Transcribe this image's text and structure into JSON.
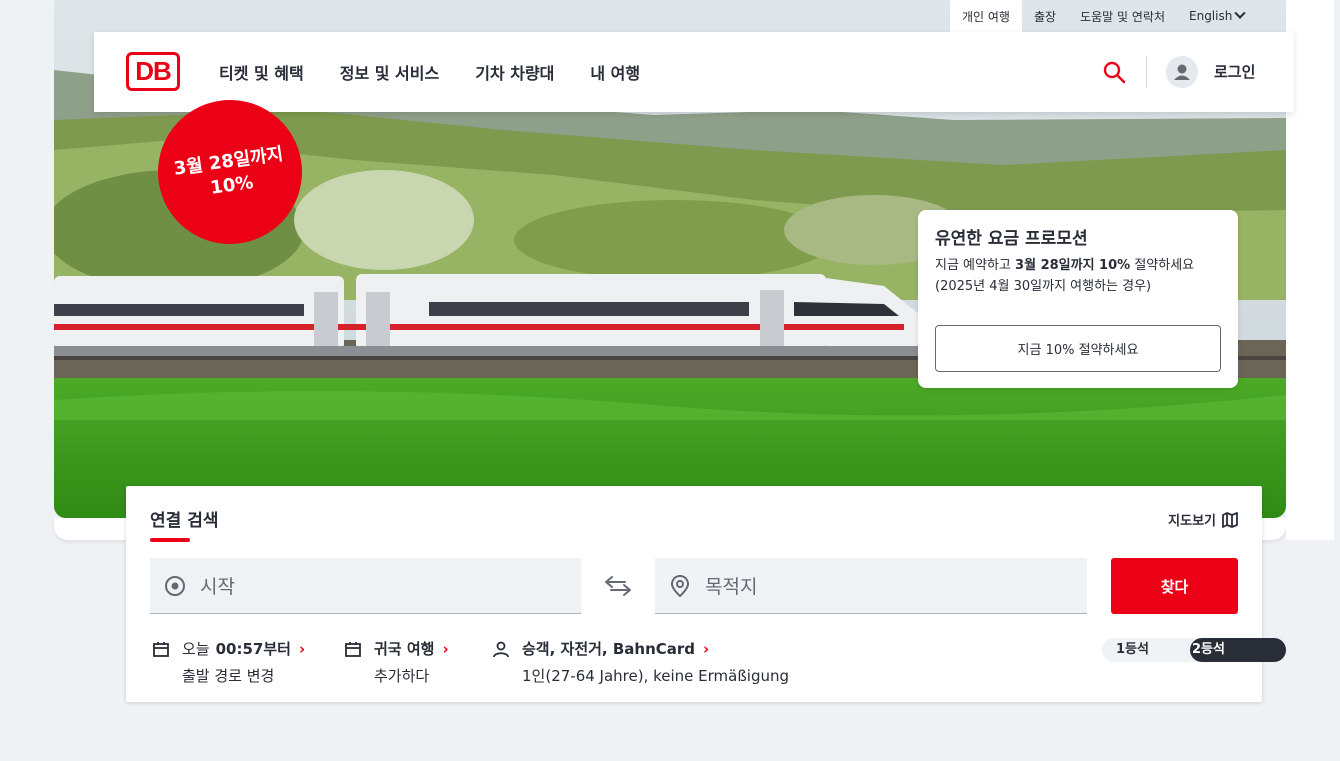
{
  "meta_nav": {
    "items": [
      {
        "label": "개인 여행"
      },
      {
        "label": "출장"
      },
      {
        "label": "도움말 및 연락처"
      }
    ],
    "language": "English"
  },
  "header": {
    "logo": "DB",
    "nav": [
      "티켓 및 혜택",
      "정보 및 서비스",
      "기차 차량대",
      "내 여행"
    ],
    "login": "로그인"
  },
  "badge": {
    "line1": "3월 28일까지",
    "line2": "10%"
  },
  "promo": {
    "title": "유연한 요금 프로모션",
    "text_pre": "지금 예약하고 ",
    "text_bold": "3월 28일까지 10%",
    "text_post": " 절약하세요 (2025년 4월 30일까지 여행하는 경우)",
    "button": "지금 10% 절약하세요"
  },
  "search": {
    "title": "연결 검색",
    "map_link": "지도보기",
    "from_placeholder": "시작",
    "to_placeholder": "목적지",
    "submit": "찾다",
    "date_label": "오늘",
    "date_bold": "00:57부터",
    "date_sub": "출발 경로 변경",
    "return_label": "귀국 여행",
    "return_sub": "추가하다",
    "passengers_label": "승객, 자전거, ",
    "passengers_bold": "BahnCard",
    "passengers_sub": "1인(27-64 Jahre), keine Ermäßigung",
    "class_1": "1등석",
    "class_2": "2등석"
  },
  "colors": {
    "brand_red": "#ec0016",
    "text": "#282d37",
    "field_bg": "#f0f3f5"
  }
}
